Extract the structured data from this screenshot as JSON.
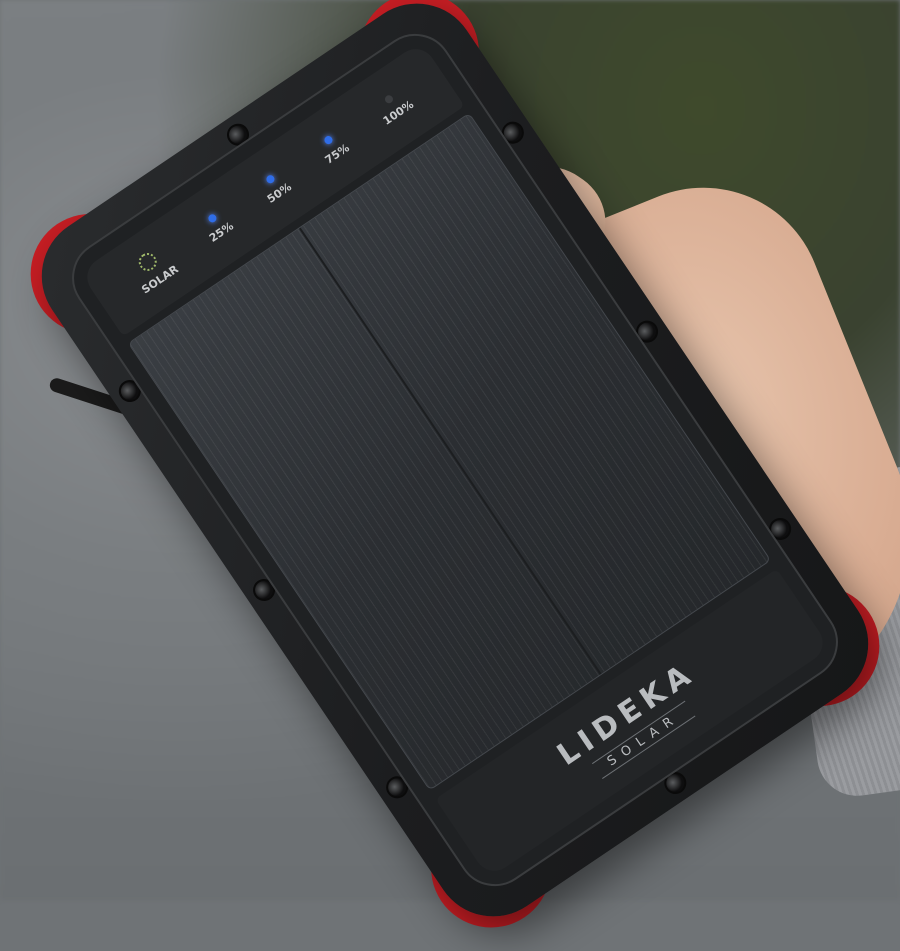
{
  "scene": {
    "description_free": true
  },
  "device": {
    "indicators": [
      {
        "label": "SOLAR",
        "led": "sun"
      },
      {
        "label": "25%",
        "led": "on"
      },
      {
        "label": "50%",
        "led": "on"
      },
      {
        "label": "75%",
        "led": "on"
      },
      {
        "label": "100%",
        "led": "off"
      }
    ],
    "brand": {
      "name": "LIDEKA",
      "sub": "SOLAR"
    }
  },
  "colors": {
    "accent_red": "#c81e24",
    "led_blue": "#2f6de8",
    "body_black": "#1c1d1f"
  }
}
